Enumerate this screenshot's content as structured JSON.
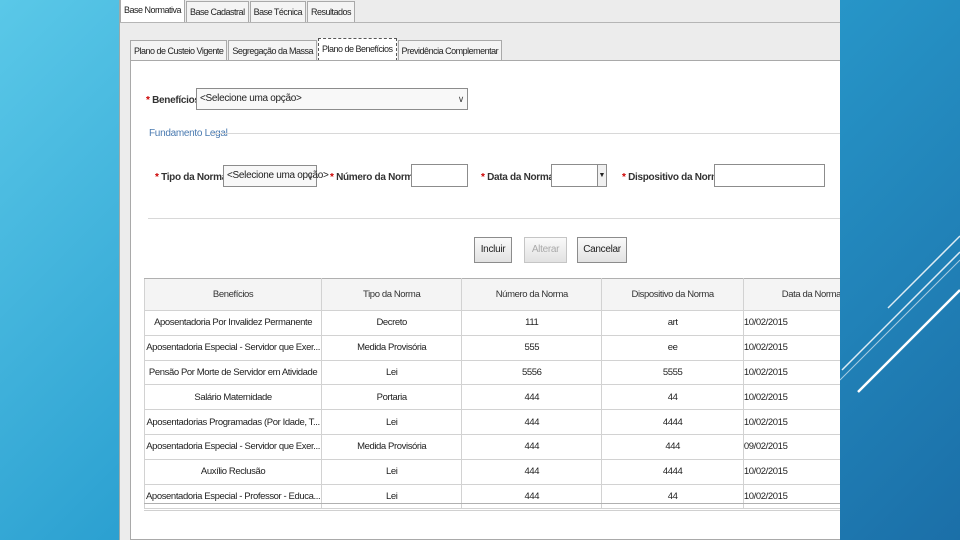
{
  "top_tabs": [
    "Base Normativa",
    "Base Cadastral",
    "Base Técnica",
    "Resultados"
  ],
  "sub_tabs": [
    "Plano de Custeio Vigente",
    "Segregação da Massa",
    "Plano de Benefícios",
    "Previdência Complementar"
  ],
  "form": {
    "beneficios": {
      "required": "*",
      "label": "Benefícios:",
      "value": "<Selecione uma opção>"
    },
    "fundamento_legal": "Fundamento Legal",
    "tipo_norma": {
      "required": "*",
      "label": "Tipo da Norma:",
      "value": "<Selecione uma opção>"
    },
    "numero_norma": {
      "required": "*",
      "label": "Número da Norma:",
      "value": ""
    },
    "data_norma": {
      "required": "*",
      "label": "Data da Norma:",
      "value": ""
    },
    "dispositivo_norma": {
      "required": "*",
      "label": "Dispositivo da Norma:",
      "value": ""
    }
  },
  "buttons": {
    "incluir": "Incluir",
    "alterar": "Alterar",
    "cancelar": "Cancelar"
  },
  "icons": {
    "dropdown": "chevron-down-icon",
    "calendar": "calendar-icon"
  },
  "table": {
    "headers": [
      "Benefícios",
      "Tipo da Norma",
      "Número da Norma",
      "Dispositivo da Norma",
      "Data da Norma"
    ],
    "rows": [
      [
        "Aposentadoria Por Invalidez Permanente",
        "Decreto",
        "111",
        "art",
        "10/02/2015"
      ],
      [
        "Aposentadoria Especial - Servidor que Exer...",
        "Medida Provisória",
        "555",
        "ee",
        "10/02/2015"
      ],
      [
        "Pensão Por Morte de Servidor em Atividade",
        "Lei",
        "5556",
        "5555",
        "10/02/2015"
      ],
      [
        "Salário Maternidade",
        "Portaria",
        "444",
        "44",
        "10/02/2015"
      ],
      [
        "Aposentadorias Programadas (Por Idade, T...",
        "Lei",
        "444",
        "4444",
        "10/02/2015"
      ],
      [
        "Aposentadoria Especial - Servidor que Exer...",
        "Medida Provisória",
        "444",
        "444",
        "09/02/2015"
      ],
      [
        "Auxílio Reclusão",
        "Lei",
        "444",
        "4444",
        "10/02/2015"
      ],
      [
        "Aposentadoria Especial - Professor - Educa...",
        "Lei",
        "444",
        "44",
        "10/02/2015"
      ]
    ]
  }
}
